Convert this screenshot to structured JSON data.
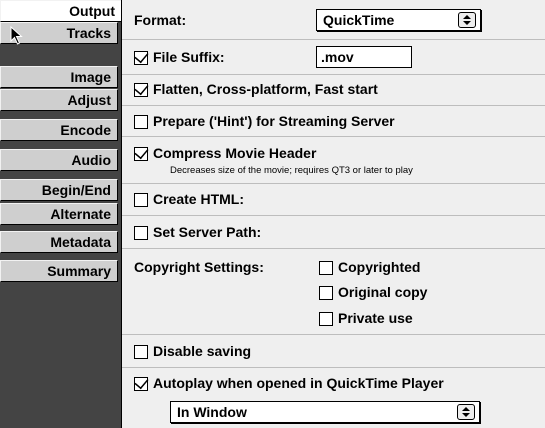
{
  "sidebar": {
    "tabs": [
      {
        "label": "Output"
      },
      {
        "label": "Tracks"
      },
      {
        "label": "Image"
      },
      {
        "label": "Adjust"
      },
      {
        "label": "Encode"
      },
      {
        "label": "Audio"
      },
      {
        "label": "Begin/End"
      },
      {
        "label": "Alternate"
      },
      {
        "label": "Metadata"
      },
      {
        "label": "Summary"
      }
    ]
  },
  "main": {
    "format_label": "Format:",
    "format_value": "QuickTime",
    "file_suffix_label": "File Suffix:",
    "file_suffix_value": ".mov",
    "flatten_label": "Flatten, Cross-platform, Fast start",
    "prepare_label": "Prepare ('Hint') for Streaming Server",
    "compress_label": "Compress Movie Header",
    "compress_note": "Decreases size of the movie; requires QT3 or later to play",
    "create_html_label": "Create HTML:",
    "server_path_label": "Set Server Path:",
    "copyright_label": "Copyright Settings:",
    "copyrighted_label": "Copyrighted",
    "original_copy_label": "Original copy",
    "private_use_label": "Private use",
    "disable_saving_label": "Disable saving",
    "autoplay_label": "Autoplay when opened in QuickTime Player",
    "autoplay_mode_value": "In Window"
  },
  "checkbox_states": {
    "file_suffix": true,
    "flatten": true,
    "prepare": false,
    "compress": true,
    "create_html": false,
    "server_path": false,
    "copyrighted": false,
    "original_copy": false,
    "private_use": false,
    "disable_saving": false,
    "autoplay": true
  }
}
